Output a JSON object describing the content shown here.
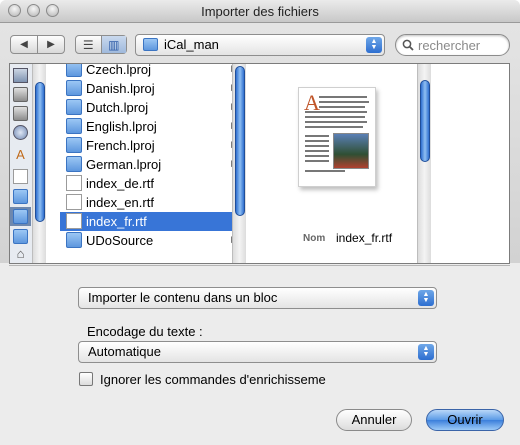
{
  "window": {
    "title": "Importer des fichiers"
  },
  "toolbar": {
    "back_glyph": "◀",
    "forward_glyph": "▶",
    "list_view_glyph": "☰",
    "column_view_glyph": "▥",
    "location": "iCal_man",
    "search_placeholder": "rechercher"
  },
  "sidebar": {
    "icons": [
      "computer-icon",
      "disk-icon",
      "disk-icon",
      "network-icon",
      "applications-icon",
      "document-icon",
      "folder-icon",
      "folder-icon",
      "folder-icon",
      "home-icon"
    ]
  },
  "browser": {
    "files": [
      {
        "name": "Czech.lproj",
        "kind": "folder",
        "chevron": "▶"
      },
      {
        "name": "Danish.lproj",
        "kind": "folder",
        "chevron": "▶"
      },
      {
        "name": "Dutch.lproj",
        "kind": "folder",
        "chevron": "▶"
      },
      {
        "name": "English.lproj",
        "kind": "folder",
        "chevron": "▶"
      },
      {
        "name": "French.lproj",
        "kind": "folder",
        "chevron": "▶"
      },
      {
        "name": "German.lproj",
        "kind": "folder",
        "chevron": "▶"
      },
      {
        "name": "index_de.rtf",
        "kind": "document",
        "chevron": ""
      },
      {
        "name": "index_en.rtf",
        "kind": "document",
        "chevron": ""
      },
      {
        "name": "index_fr.rtf",
        "kind": "document",
        "chevron": "",
        "selected": true
      },
      {
        "name": "UDoSource",
        "kind": "folder",
        "chevron": "▶"
      }
    ],
    "preview": {
      "drop_cap": "A",
      "name_label": "Nom",
      "name_value": "index_fr.rtf"
    }
  },
  "options": {
    "import_mode": "Importer le contenu dans un bloc",
    "encoding_label": "Encodage du texte :",
    "encoding_value": "Automatique",
    "ignore_label": "Ignorer les commandes d'enrichisseme",
    "ignore_checked": false
  },
  "buttons": {
    "cancel": "Annuler",
    "open": "Ouvrir"
  },
  "colors": {
    "selection": "#3875d7",
    "accent": "#3b7fdb"
  }
}
